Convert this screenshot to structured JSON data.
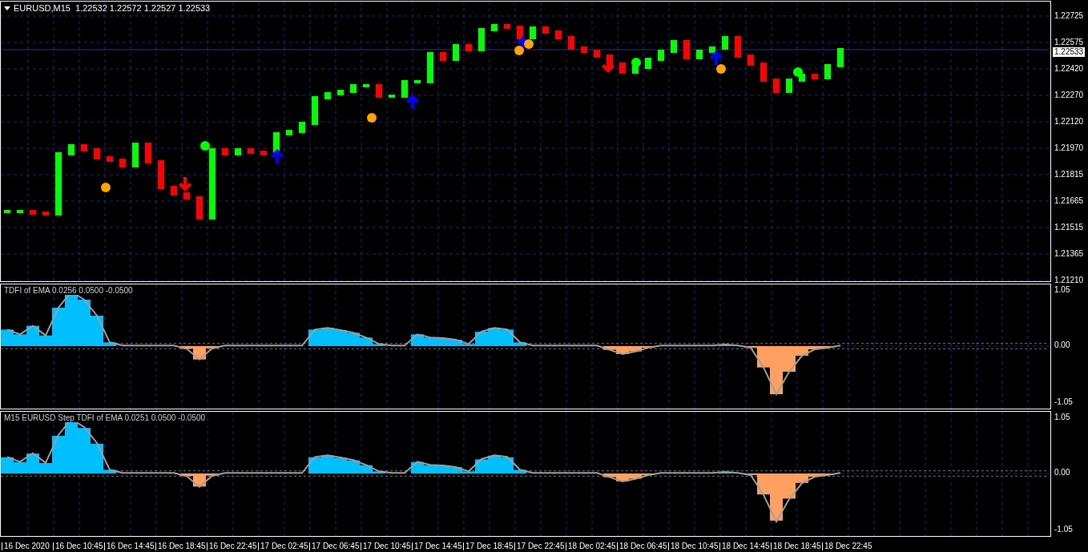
{
  "main_chart": {
    "header": "EURUSD,M15  1.22532 1.22572 1.22527 1.22533",
    "current_price": "1.22533",
    "price_axis": [
      "1.22725",
      "1.22575",
      "1.22420",
      "1.22270",
      "1.22120",
      "1.21970",
      "1.21815",
      "1.21665",
      "1.21515",
      "1.21365",
      "1.21210"
    ]
  },
  "indicator_panels": [
    {
      "header": "TDFI of EMA 0.0256 0.0500 -0.0500",
      "axis": [
        "1.05",
        "0.00",
        "-1.05"
      ]
    },
    {
      "header": "M15 EURUSD Step TDFI of EMA 0.0251 0.0500 -0.0500",
      "axis": [
        "1.05",
        "0.00",
        "-1.05"
      ]
    }
  ],
  "time_axis": [
    "16 Dec 2020",
    "16 Dec 10:45",
    "16 Dec 14:45",
    "16 Dec 18:45",
    "16 Dec 22:45",
    "17 Dec 02:45",
    "17 Dec 06:45",
    "17 Dec 10:45",
    "17 Dec 14:45",
    "17 Dec 18:45",
    "17 Dec 22:45",
    "18 Dec 02:45",
    "18 Dec 06:45",
    "18 Dec 10:45",
    "18 Dec 14:45",
    "18 Dec 18:45",
    "18 Dec 22:45"
  ]
}
